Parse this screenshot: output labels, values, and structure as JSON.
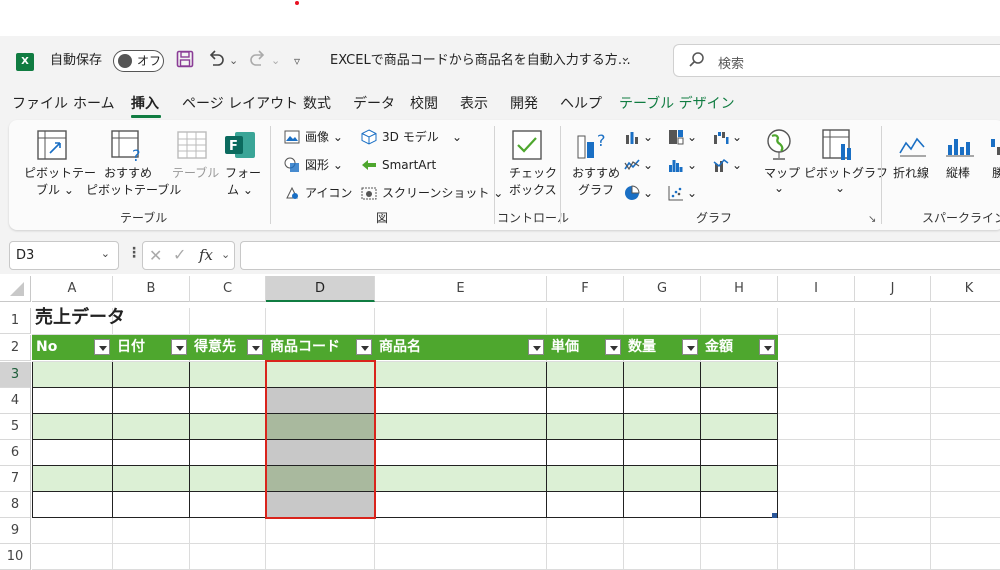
{
  "titlebar": {
    "autosave_label": "自動保存",
    "autosave_toggle": "オフ",
    "document_title": "EXCELで商品コードから商品名を自動入力する方…",
    "search_placeholder": "検索"
  },
  "menu": {
    "items": [
      "ファイル",
      "ホーム",
      "挿入",
      "ページ レイアウト",
      "数式",
      "データ",
      "校閲",
      "表示",
      "開発",
      "ヘルプ",
      "テーブル デザイン"
    ],
    "active": "挿入"
  },
  "ribbon": {
    "pivot_table": [
      "ピボットテー",
      "ブル ⌄"
    ],
    "recommended_pivot": [
      "おすすめ",
      "ピボットテーブル"
    ],
    "table": "テーブル",
    "forms": [
      "フォー",
      "ム ⌄"
    ],
    "group_table": "テーブル",
    "images": "画像 ⌄",
    "shapes": "図形 ⌄",
    "icons": "アイコン",
    "model_3d": "3D モデル",
    "smartart": "SmartArt",
    "screenshot": "スクリーンショット ⌄",
    "group_illustrations": "図",
    "checkbox": [
      "チェック",
      "ボックス"
    ],
    "group_controls": "コントロール",
    "recommended_charts": [
      "おすすめ",
      "グラフ"
    ],
    "maps": [
      "マップ",
      "⌄"
    ],
    "pivot_chart": [
      "ピボットグラフ",
      "⌄"
    ],
    "group_charts": "グラフ",
    "sparkline_line": "折れ線",
    "sparkline_column": "縦棒",
    "sparkline_winloss": "勝",
    "group_sparklines": "スパークライン"
  },
  "formula_bar": {
    "name_box": "D3",
    "fx": "fx",
    "content": ""
  },
  "grid": {
    "columns": [
      "A",
      "B",
      "C",
      "D",
      "E",
      "F",
      "G",
      "H",
      "I",
      "J",
      "K"
    ],
    "rows": [
      "1",
      "2",
      "3",
      "4",
      "5",
      "6",
      "7",
      "8",
      "9",
      "10"
    ],
    "selected_column": "D",
    "selected_row": "3",
    "sheet_title": "売上データ",
    "table_headers": [
      "No",
      "日付",
      "得意先",
      "商品コード",
      "商品名",
      "単価",
      "数量",
      "金額"
    ]
  },
  "colors": {
    "excel_green": "#107c41",
    "header_green": "#4ea72e",
    "band_green": "#dcf0d5",
    "selection_gray": "#c8c8c8",
    "selection_band": "#a9b99e",
    "highlight_red": "#d9241c"
  }
}
